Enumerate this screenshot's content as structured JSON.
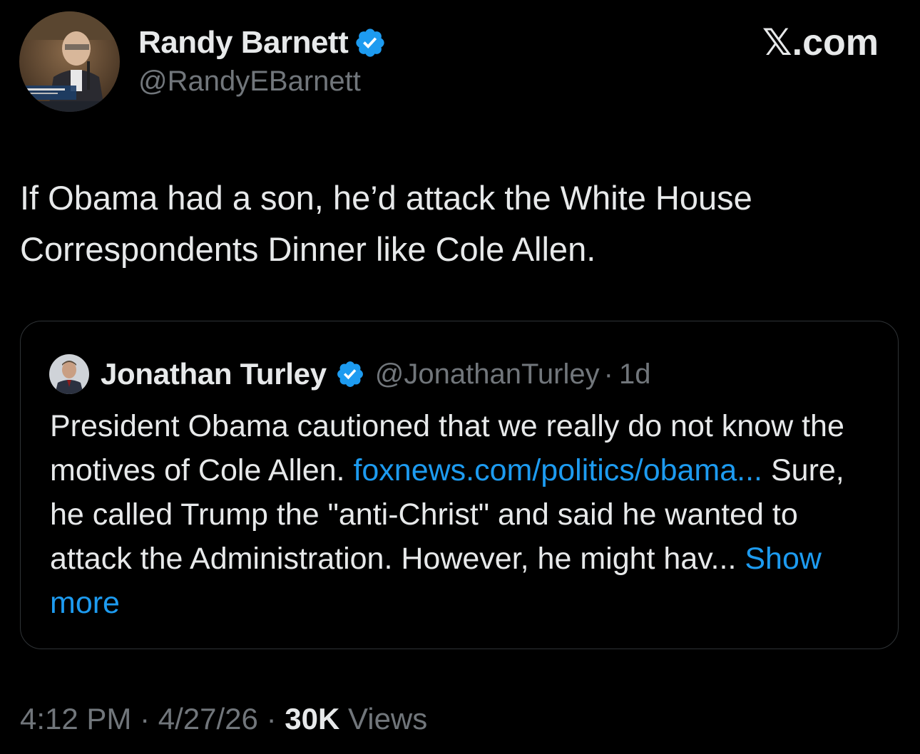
{
  "author": {
    "name": "Randy Barnett",
    "handle": "@RandyEBarnett",
    "verified": true,
    "avatar": "avatar-photo-speaker-at-podium"
  },
  "brand": {
    "label": "𝕏.com"
  },
  "tweet": {
    "text_line1": "If Obama had a son, he’d attack the White House",
    "text_line2": "Correspondents Dinner like Cole Allen."
  },
  "quote": {
    "author_name": "Jonathan Turley",
    "author_handle": "@JonathanTurley",
    "separator": "·",
    "age": "1d",
    "verified": true,
    "avatar": "avatar-photo-man-in-suit",
    "text_before_link": "President Obama cautioned that we really do not know the motives of Cole Allen.",
    "link": "foxnews.com/politics/obama...",
    "text_after_link": "Sure, he called Trump the \"anti-Christ\" and said he wanted to attack the Administration. However, he might hav...",
    "show_more": "Show more"
  },
  "meta": {
    "time": "4:12 PM",
    "date": "4/27/26",
    "views_count": "30K",
    "views_label": "Views",
    "separator": "·"
  },
  "colors": {
    "background": "#000000",
    "text_primary": "#e7e9ea",
    "text_secondary": "#71767b",
    "link": "#1d9bf0",
    "verified": "#1d9bf0",
    "border": "#2f3336"
  }
}
